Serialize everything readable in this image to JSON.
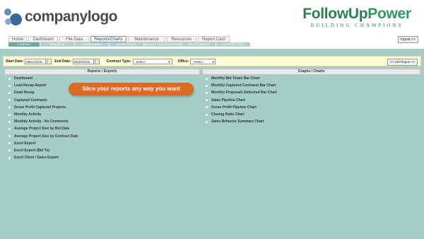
{
  "header": {
    "logo_text": "companylogo",
    "brand_prefix": "FollowUp",
    "brand_power": "Power",
    "brand_tagline": "BUILDING CHAMPIONS"
  },
  "nav": {
    "tabs": [
      "Home",
      "Dashboard",
      "File Data",
      "Reports/Charts",
      "Maintenance",
      "Resources",
      "Report Card"
    ],
    "active_tab": "Reports/Charts",
    "subtabs": [
      "COMPANY",
      "INDIVIDUAL",
      "MANAGEMENT",
      "SALES GOALS",
      "MANAGE SALES PERSONS",
      "SALES GRAPHS",
      "COMPANY STATS"
    ],
    "logout": "logout >>"
  },
  "filters": {
    "start_label": "Start Date:",
    "start_value": "06/01/2015",
    "end_label": "End Date:",
    "end_value": "06/30/2015",
    "contract_label": "Contract Type:",
    "contract_value": "- Select -",
    "office_label": "Office:",
    "office_value": "- Select -",
    "calendar_glyph": "...",
    "get_report": "<< Get Report >>"
  },
  "reports": {
    "header": "Reports / Exports",
    "items": [
      "Dashboard",
      "Lead Recap Report",
      "Dead Recap",
      "Captured Contracts",
      "Gross Profit Captured Projects",
      "Monthly Activity",
      "Monthly Activity - No Comments",
      "Average Project Size by Bid Date",
      "Average Project Size by Contract Date",
      "Excel Export",
      "Excel Export (Bid To)",
      "Excel Client / Sales Export"
    ]
  },
  "graphs": {
    "header": "Graphs / Charts",
    "items": [
      "Monthly Bid Totals Bar Chart",
      "Monthly Captured Contracts Bar Chart",
      "Monthly Proposals Delivered Bar Chart",
      "Sales Pipeline Chart",
      "Gross Profit Pipeline Chart",
      "Closing Ratio Chart",
      "Sales Behavior Summary Chart"
    ]
  },
  "callout": "Slice your reports any way you want"
}
